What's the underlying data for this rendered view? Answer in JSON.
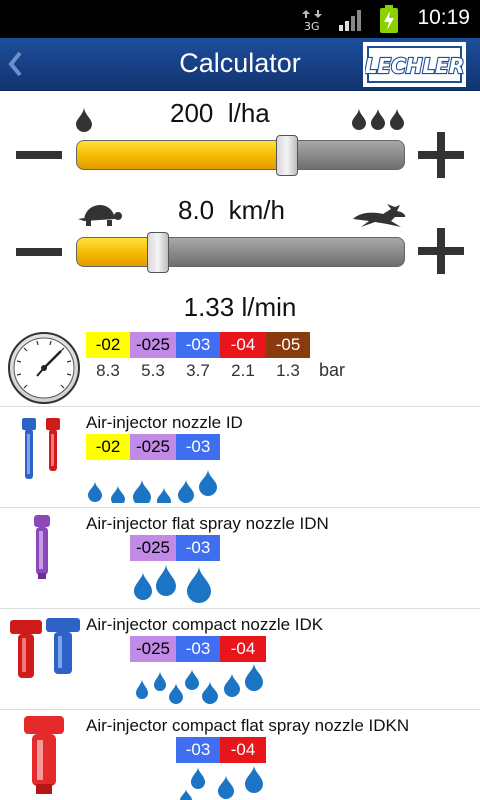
{
  "status_bar": {
    "network": "3G",
    "time": "10:19"
  },
  "header": {
    "title": "Calculator",
    "logo_text": "LECHLER",
    "back_icon": "chevron-left-icon"
  },
  "rate": {
    "value": "200",
    "unit": "l/ha",
    "fill_fraction": 0.64
  },
  "speed": {
    "value": "8.0",
    "unit": "km/h",
    "fill_fraction": 0.25
  },
  "flow": {
    "value": "1.33 l/min"
  },
  "pressure": {
    "chips": [
      {
        "label": "-02",
        "color": "#ffff00",
        "text_color": "#000000"
      },
      {
        "label": "-025",
        "color": "#c08ae6",
        "text_color": "#000000"
      },
      {
        "label": "-03",
        "color": "#3f6ff0",
        "text_color": "#ffffff"
      },
      {
        "label": "-04",
        "color": "#e8151b",
        "text_color": "#ffffff"
      },
      {
        "label": "-05",
        "color": "#8a3b0e",
        "text_color": "#ffffff"
      }
    ],
    "values": [
      "8.3",
      "5.3",
      "3.7",
      "2.1",
      "1.3"
    ],
    "unit": "bar"
  },
  "nozzles": [
    {
      "name": "Air-injector nozzle ID",
      "chips": [
        "-02",
        "-025",
        "-03"
      ]
    },
    {
      "name": "Air-injector flat spray nozzle IDN",
      "chips": [
        "-025",
        "-03"
      ]
    },
    {
      "name": "Air-injector compact nozzle IDK",
      "chips": [
        "-025",
        "-03",
        "-04"
      ]
    },
    {
      "name": "Air-injector compact flat spray nozzle IDKN",
      "chips": [
        "-03",
        "-04"
      ]
    }
  ]
}
